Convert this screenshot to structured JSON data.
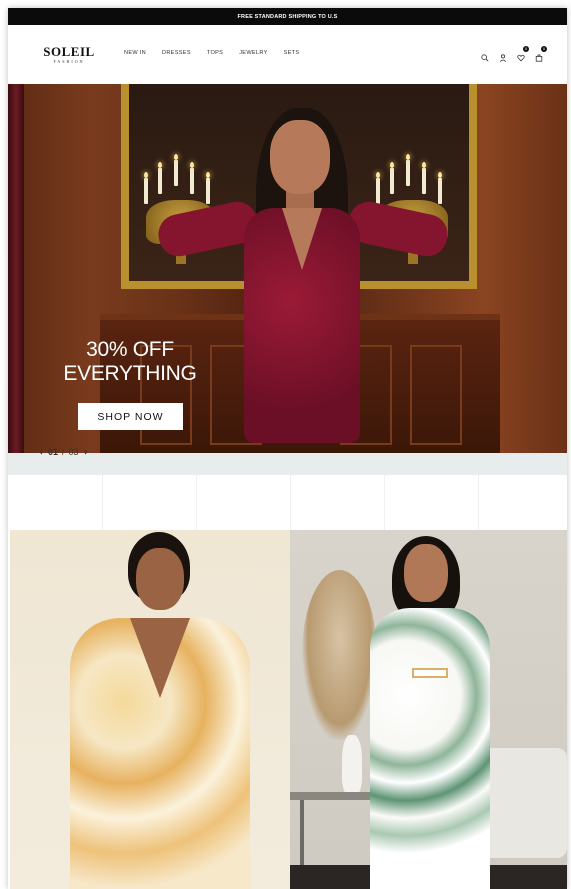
{
  "announcement": "FREE STANDARD SHIPPING TO U.S",
  "logo": {
    "brand": "SOLEIL",
    "sub": "FASHION"
  },
  "menu": [
    "NEW IN",
    "DRESSES",
    "TOPS",
    "JEWELRY",
    "SETS"
  ],
  "icons": {
    "search": "search-icon",
    "account": "user-icon",
    "wishlist": "heart-icon",
    "cart": "bag-icon",
    "wishlist_count": "0",
    "cart_count": "0"
  },
  "hero": {
    "line1": "30% OFF",
    "line2": "EVERYTHING",
    "cta": "SHOP NOW",
    "slide_current": "01",
    "slide_total": "03",
    "prev_icon": "chevron-left-icon",
    "next_icon": "chevron-right-icon"
  }
}
